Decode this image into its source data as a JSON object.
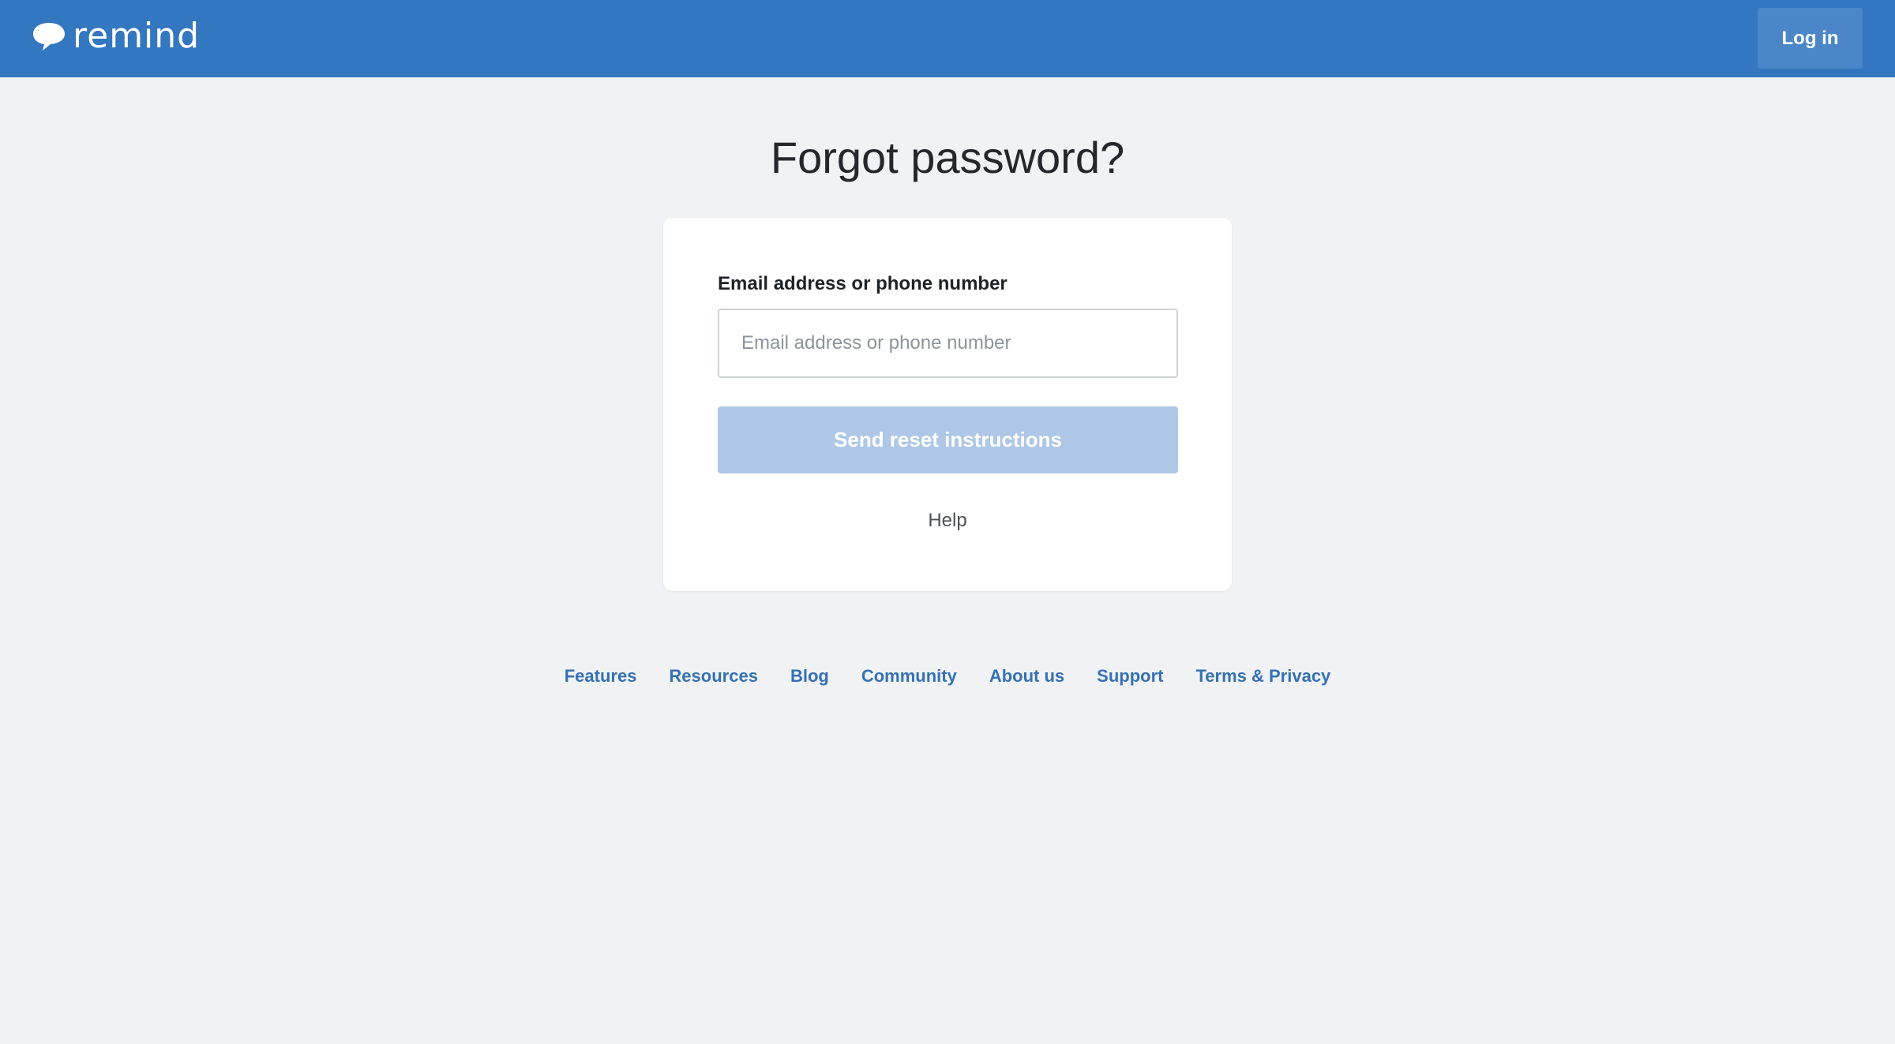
{
  "header": {
    "logo_text": "remind",
    "logo_icon": "speech-bubble-icon",
    "login_label": "Log in",
    "colors": {
      "bar": "#3377c0",
      "login_button": "#4a86c8"
    }
  },
  "main": {
    "title": "Forgot password?",
    "form": {
      "field_label": "Email address or phone number",
      "input_value": "",
      "input_placeholder": "Email address or phone number",
      "submit_label": "Send reset instructions",
      "submit_color": "#aec7e6",
      "help_label": "Help"
    }
  },
  "footer": {
    "links": [
      {
        "label": "Features"
      },
      {
        "label": "Resources"
      },
      {
        "label": "Blog"
      },
      {
        "label": "Community"
      },
      {
        "label": "About us"
      },
      {
        "label": "Support"
      },
      {
        "label": "Terms & Privacy"
      }
    ],
    "link_color": "#3571b3"
  }
}
